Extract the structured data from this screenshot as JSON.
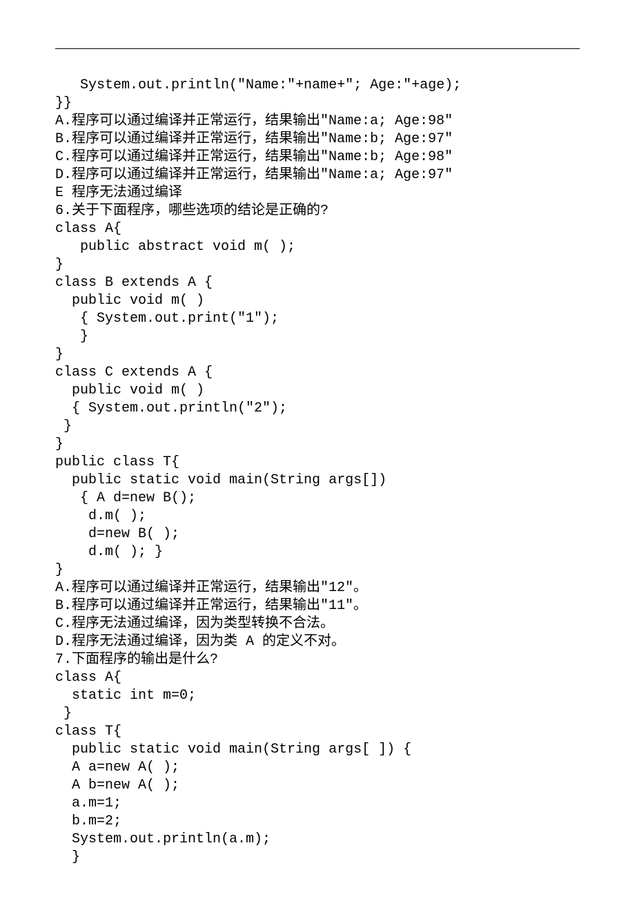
{
  "lines": [
    "   System.out.println(\"Name:\"+name+\"; Age:\"+age);",
    "}}",
    "A.程序可以通过编译并正常运行，结果输出\"Name:a; Age:98\"",
    "B.程序可以通过编译并正常运行，结果输出\"Name:b; Age:97\"",
    "C.程序可以通过编译并正常运行，结果输出\"Name:b; Age:98\"",
    "D.程序可以通过编译并正常运行，结果输出\"Name:a; Age:97\"",
    "E 程序无法通过编译",
    "6.关于下面程序，哪些选项的结论是正确的?",
    "class A{",
    "   public abstract void m( );",
    "}",
    "class B extends A {",
    "  public void m( )",
    "   { System.out.print(\"1\");",
    "   }",
    "}",
    "class C extends A {",
    "  public void m( )",
    "  { System.out.println(\"2\");",
    " }",
    "}",
    "public class T{",
    "  public static void main(String args[])",
    "   { A d=new B();",
    "    d.m( );",
    "    d=new B( );",
    "    d.m( ); }",
    "}",
    "A.程序可以通过编译并正常运行，结果输出\"12\"。",
    "B.程序可以通过编译并正常运行，结果输出\"11\"。",
    "C.程序无法通过编译，因为类型转换不合法。",
    "D.程序无法通过编译，因为类 A 的定义不对。",
    "7.下面程序的输出是什么?",
    "class A{",
    "  static int m=0;",
    " }",
    "class T{",
    "  public static void main(String args[ ]) {",
    "  A a=new A( );",
    "  A b=new A( );",
    "  a.m=1;",
    "  b.m=2;",
    "  System.out.println(a.m);",
    "  }"
  ]
}
